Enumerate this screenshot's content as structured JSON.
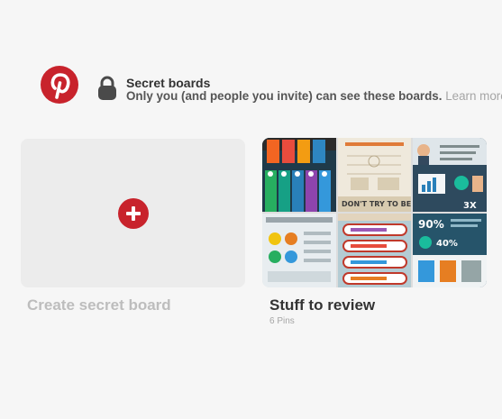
{
  "brand": {
    "logo_icon": "pinterest-logo",
    "color": "#c8232c"
  },
  "secret": {
    "icon": "lock-icon",
    "title": "Secret boards",
    "description": "Only you (and people you invite) can see these boards.",
    "learn_more": "Learn more"
  },
  "create_board": {
    "icon": "plus-icon",
    "label": "Create secret board"
  },
  "boards": [
    {
      "title": "Stuff to review",
      "pin_count": "6 Pins",
      "cover_text": "DON'T TRY TO BE ORIGINAL",
      "stat_1": "3X",
      "stat_2": "90%",
      "stat_3": "40%"
    }
  ]
}
